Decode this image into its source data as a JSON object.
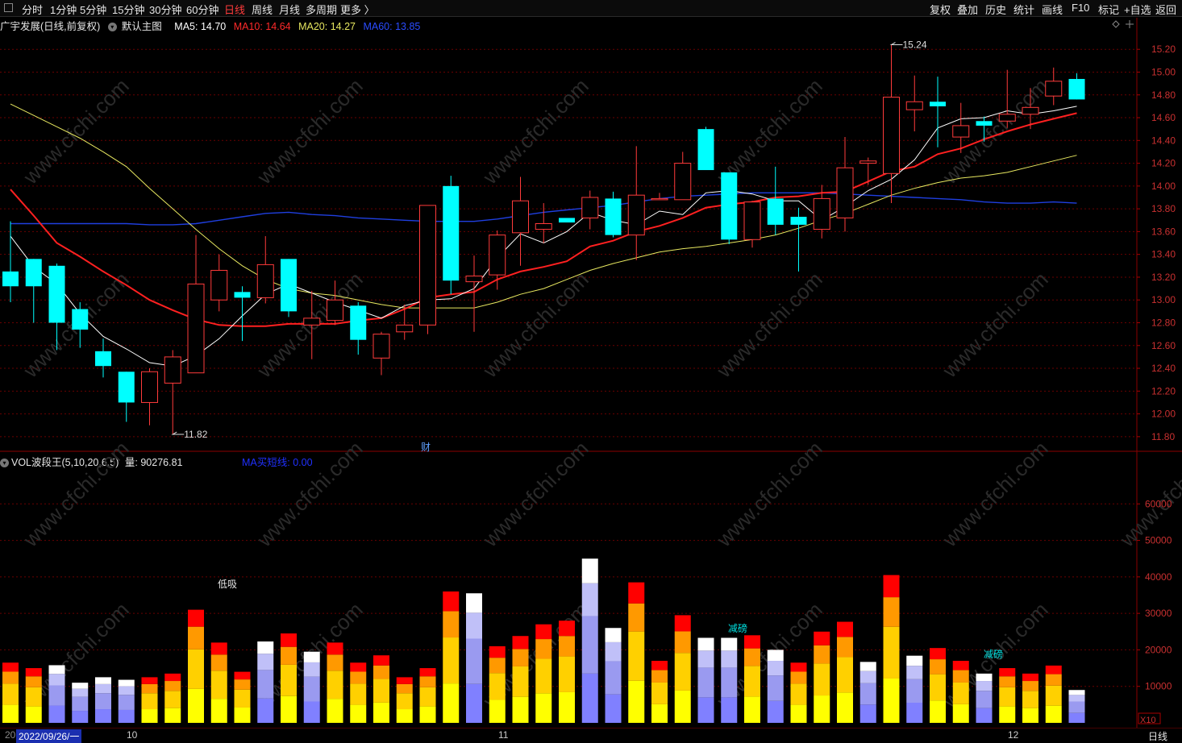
{
  "toolbar": {
    "left": [
      "分时",
      "1分钟",
      "5分钟",
      "15分钟",
      "30分钟",
      "60分钟",
      "日线",
      "周线",
      "月线",
      "多周期",
      "更多 〉"
    ],
    "active": "日线",
    "right": [
      "复权",
      "叠加",
      "历史",
      "统计",
      "画线",
      "F10",
      "标记",
      "+自选",
      "返回"
    ]
  },
  "main_info": {
    "title": "广宇发展(日线,前复权)",
    "template": "默认主图",
    "ma5": "MA5: 14.70",
    "ma10": "MA10: 14.64",
    "ma20": "MA20: 14.27",
    "ma60": "MA60: 13.85"
  },
  "vol_info": {
    "title": "VOL波段王(5,10,20,6,5)",
    "volume": "量: 90276.81",
    "ma_label": "MA买短线: 0.00"
  },
  "annotations": {
    "high": "15.24",
    "low": "11.82",
    "finance_mark": "财",
    "low_buy": "低吸",
    "reduce_1": "减磅",
    "reduce_2": "减磅"
  },
  "bottom_bar": {
    "date": "2022/09/26/一",
    "m10": "10",
    "m11": "11",
    "m12": "12",
    "period": "日线",
    "x10": "X10",
    "cut": "20"
  },
  "watermark": "www.cfchi.com",
  "colors": {
    "up": "#ff3b3b",
    "down": "#00ffff",
    "ma5": "#ffffff",
    "ma10": "#ff2020",
    "ma20": "#e8e860",
    "ma60": "#1f3fe0",
    "grid": "#6a0000"
  },
  "chart_data": [
    {
      "type": "candlestick",
      "name": "price",
      "ylim": [
        11.7,
        15.35
      ],
      "yticks": [
        "15.20",
        "15.00",
        "14.80",
        "14.60",
        "14.40",
        "14.20",
        "14.00",
        "13.80",
        "13.60",
        "13.40",
        "13.20",
        "13.00",
        "12.80",
        "12.60",
        "12.40",
        "12.20",
        "12.00",
        "11.80"
      ],
      "candles": [
        [
          13.25,
          13.12,
          13.69,
          12.98
        ],
        [
          13.36,
          13.12,
          13.36,
          12.8
        ],
        [
          13.3,
          12.8,
          13.32,
          12.56
        ],
        [
          12.92,
          12.74,
          12.98,
          12.58
        ],
        [
          12.55,
          12.42,
          12.66,
          12.32
        ],
        [
          12.37,
          12.1,
          12.37,
          11.93
        ],
        [
          12.1,
          12.37,
          12.4,
          11.9
        ],
        [
          12.27,
          12.5,
          12.56,
          11.82
        ],
        [
          12.36,
          13.14,
          13.57,
          12.36
        ],
        [
          13.0,
          13.26,
          13.4,
          12.9
        ],
        [
          13.07,
          13.02,
          13.12,
          12.64
        ],
        [
          13.02,
          13.31,
          13.56,
          12.97
        ],
        [
          13.36,
          12.9,
          13.36,
          12.85
        ],
        [
          12.78,
          12.84,
          13.08,
          12.48
        ],
        [
          12.82,
          13.0,
          13.17,
          12.78
        ],
        [
          12.95,
          12.65,
          12.98,
          12.52
        ],
        [
          12.49,
          12.7,
          12.72,
          12.34
        ],
        [
          12.72,
          12.78,
          12.96,
          12.65
        ],
        [
          12.78,
          13.83,
          13.83,
          12.7
        ],
        [
          14.0,
          13.17,
          14.09,
          13.05
        ],
        [
          13.16,
          13.21,
          13.39,
          12.72
        ],
        [
          13.22,
          13.57,
          13.61,
          13.09
        ],
        [
          13.59,
          13.87,
          14.08,
          13.3
        ],
        [
          13.62,
          13.67,
          13.85,
          13.5
        ],
        [
          13.72,
          13.68,
          13.72,
          13.72
        ],
        [
          13.72,
          13.9,
          13.96,
          13.62
        ],
        [
          13.89,
          13.57,
          13.95,
          13.55
        ],
        [
          13.57,
          13.92,
          14.35,
          13.35
        ],
        [
          13.88,
          13.89,
          13.94,
          13.88
        ],
        [
          13.88,
          14.2,
          14.3,
          13.88
        ],
        [
          14.5,
          14.14,
          14.52,
          14.14
        ],
        [
          14.12,
          13.53,
          14.12,
          13.49
        ],
        [
          13.53,
          13.86,
          13.87,
          13.46
        ],
        [
          13.89,
          13.66,
          14.17,
          13.57
        ],
        [
          13.73,
          13.66,
          13.81,
          13.25
        ],
        [
          13.62,
          13.89,
          14.01,
          13.54
        ],
        [
          13.72,
          14.16,
          14.43,
          13.6
        ],
        [
          14.2,
          14.22,
          14.25,
          14.01
        ],
        [
          14.11,
          14.78,
          15.24,
          13.85
        ],
        [
          14.67,
          14.74,
          14.97,
          14.48
        ],
        [
          14.74,
          14.7,
          14.96,
          14.34
        ],
        [
          14.43,
          14.53,
          14.73,
          14.29
        ],
        [
          14.57,
          14.53,
          14.61,
          14.39
        ],
        [
          14.57,
          14.63,
          15.02,
          14.51
        ],
        [
          14.63,
          14.69,
          14.86,
          14.5
        ],
        [
          14.79,
          14.92,
          15.04,
          14.71
        ],
        [
          14.94,
          14.76,
          14.99,
          14.76
        ]
      ],
      "ma5": [
        13.56,
        13.29,
        13.14,
        12.88,
        12.68,
        12.57,
        12.45,
        12.42,
        12.51,
        12.66,
        12.86,
        13.05,
        13.14,
        13.06,
        12.98,
        12.91,
        12.84,
        12.95,
        13.0,
        13.01,
        13.1,
        13.37,
        13.58,
        13.5,
        13.6,
        13.77,
        13.7,
        13.66,
        13.78,
        13.75,
        13.94,
        13.96,
        13.93,
        13.87,
        13.87,
        13.7,
        13.82,
        13.96,
        14.06,
        14.23,
        14.51,
        14.59,
        14.6,
        14.66,
        14.63,
        14.66,
        14.7
      ],
      "ma10": [
        13.97,
        13.74,
        13.5,
        13.38,
        13.25,
        13.13,
        13.0,
        12.91,
        12.83,
        12.78,
        12.77,
        12.77,
        12.79,
        12.79,
        12.79,
        12.82,
        12.84,
        12.92,
        13.02,
        13.05,
        13.07,
        13.18,
        13.25,
        13.29,
        13.34,
        13.47,
        13.52,
        13.6,
        13.65,
        13.72,
        13.81,
        13.84,
        13.86,
        13.9,
        13.91,
        13.94,
        13.95,
        14.04,
        14.13,
        14.17,
        14.28,
        14.33,
        14.41,
        14.48,
        14.54,
        14.59,
        14.64
      ],
      "ma20": [
        14.72,
        14.62,
        14.52,
        14.42,
        14.3,
        14.17,
        13.98,
        13.8,
        13.62,
        13.45,
        13.3,
        13.18,
        13.1,
        13.06,
        13.04,
        13.0,
        12.96,
        12.93,
        12.93,
        12.93,
        12.93,
        12.98,
        13.05,
        13.1,
        13.18,
        13.26,
        13.32,
        13.37,
        13.42,
        13.45,
        13.47,
        13.5,
        13.53,
        13.57,
        13.63,
        13.7,
        13.76,
        13.84,
        13.92,
        13.98,
        14.03,
        14.07,
        14.09,
        14.12,
        14.17,
        14.22,
        14.27
      ],
      "ma60": [
        13.67,
        13.67,
        13.67,
        13.67,
        13.67,
        13.67,
        13.66,
        13.66,
        13.67,
        13.7,
        13.73,
        13.76,
        13.77,
        13.75,
        13.74,
        13.72,
        13.71,
        13.7,
        13.69,
        13.69,
        13.69,
        13.71,
        13.74,
        13.77,
        13.79,
        13.81,
        13.83,
        13.86,
        13.89,
        13.91,
        13.92,
        13.93,
        13.94,
        13.94,
        13.94,
        13.94,
        13.93,
        13.92,
        13.91,
        13.9,
        13.89,
        13.88,
        13.86,
        13.85,
        13.85,
        13.86,
        13.85
      ]
    },
    {
      "type": "bar",
      "name": "volume",
      "ylim": [
        0,
        70000
      ],
      "yticks": [
        "60000",
        "50000",
        "40000",
        "30000",
        "20000",
        "10000"
      ],
      "values": [
        16500,
        15000,
        15800,
        11000,
        12500,
        11800,
        12500,
        13500,
        31000,
        22000,
        14000,
        22300,
        24500,
        19500,
        22000,
        16500,
        18500,
        12500,
        15000,
        36000,
        35500,
        21000,
        23800,
        27000,
        28000,
        45000,
        26000,
        38500,
        17000,
        29500,
        23300,
        23300,
        24000,
        20000,
        16500,
        25000,
        27700,
        16700,
        40500,
        18400,
        20500,
        17000,
        13500,
        15000,
        13500,
        15700,
        9000
      ],
      "up": [
        true,
        true,
        false,
        false,
        false,
        false,
        true,
        true,
        true,
        true,
        true,
        false,
        true,
        false,
        true,
        true,
        true,
        true,
        true,
        true,
        false,
        true,
        true,
        true,
        true,
        false,
        false,
        true,
        true,
        true,
        false,
        false,
        true,
        false,
        true,
        true,
        true,
        false,
        true,
        false,
        true,
        true,
        false,
        true,
        true,
        true,
        false
      ]
    }
  ]
}
